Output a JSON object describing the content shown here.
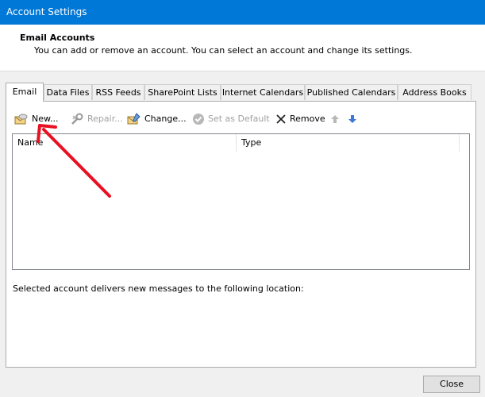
{
  "window": {
    "title": "Account Settings"
  },
  "header": {
    "title": "Email Accounts",
    "subtitle": "You can add or remove an account. You can select an account and change its settings."
  },
  "tabs": [
    {
      "label": "Email",
      "active": true
    },
    {
      "label": "Data Files"
    },
    {
      "label": "RSS Feeds"
    },
    {
      "label": "SharePoint Lists"
    },
    {
      "label": "Internet Calendars"
    },
    {
      "label": "Published Calendars"
    },
    {
      "label": "Address Books"
    }
  ],
  "toolbar": {
    "new_label": "New...",
    "repair_label": "Repair...",
    "change_label": "Change...",
    "set_default_label": "Set as Default",
    "remove_label": "Remove"
  },
  "list": {
    "columns": [
      "Name",
      "Type"
    ],
    "rows": []
  },
  "delivery_text": "Selected account delivers new messages to the following location:",
  "footer": {
    "close_label": "Close"
  },
  "colors": {
    "titlebar": "#0078d7",
    "annotation_arrow": "#e81123",
    "move_arrow": "#3c78d8"
  },
  "icons": [
    "mailbox-icon",
    "wrench-icon",
    "change-account-icon",
    "check-circle-icon",
    "x-icon",
    "arrow-up-icon",
    "arrow-down-icon"
  ]
}
